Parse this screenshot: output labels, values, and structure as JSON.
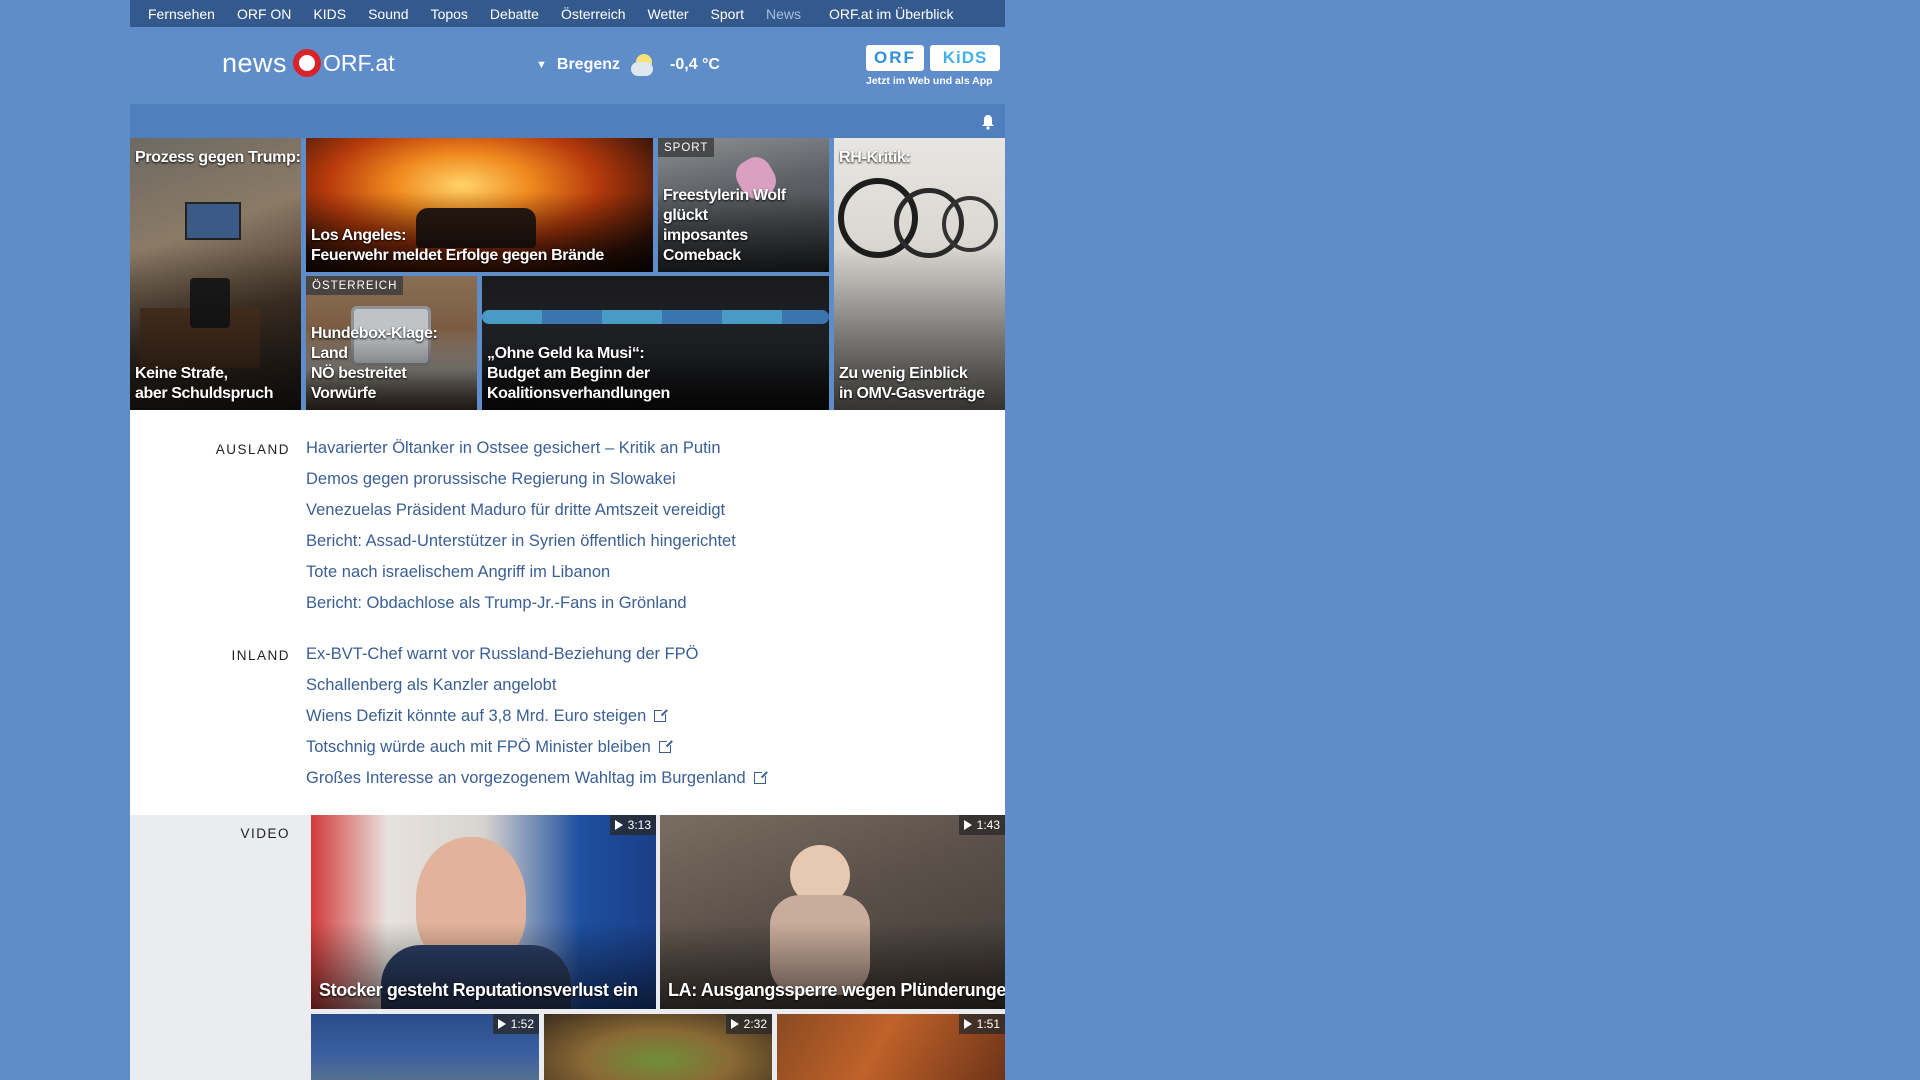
{
  "nav": {
    "items": [
      "Fernsehen",
      "ORF ON",
      "KIDS",
      "Sound",
      "Topos",
      "Debatte",
      "Österreich",
      "Wetter",
      "Sport",
      "News"
    ],
    "active": "News",
    "overview": "ORF.at im Überblick"
  },
  "header": {
    "logo_news": "news",
    "logo_orf": "ORF.at",
    "weather_city": "Bregenz",
    "weather_temp": "-0,4 °C",
    "weather_icon": "partly-cloudy-night-icon",
    "kids_orf": "ORF",
    "kids_label": "KiDS",
    "kids_tagline": "Jetzt im Web und als App"
  },
  "top_stories": [
    {
      "kicker": "Prozess gegen Trump:",
      "headline": "Keine Strafe,\naber Schuldspruch",
      "tag": ""
    },
    {
      "kicker": "",
      "headline": "Los Angeles:\nFeuerwehr meldet Erfolge gegen Brände",
      "tag": ""
    },
    {
      "kicker": "",
      "headline": "Freestylerin Wolf glückt\nimposantes Comeback",
      "tag": "SPORT"
    },
    {
      "kicker": "RH-Kritik:",
      "headline": "Zu wenig Einblick\nin OMV-Gasverträge",
      "tag": ""
    },
    {
      "kicker": "",
      "headline": "Hundebox-Klage: Land\nNÖ bestreitet Vorwürfe",
      "tag": "ÖSTERREICH"
    },
    {
      "kicker": "",
      "headline": "„Ohne Geld ka Musi“:\nBudget am Beginn der Koalitionsverhandlungen",
      "tag": ""
    }
  ],
  "ausland": {
    "label": "AUSLAND",
    "links": [
      "Havarierter Öltanker in Ostsee gesichert – Kritik an Putin",
      "Demos gegen prorussische Regierung in Slowakei",
      "Venezuelas Präsident Maduro für dritte Amtszeit vereidigt",
      "Bericht: Assad-Unterstützer in Syrien öffentlich hingerichtet",
      "Tote nach israelischem Angriff im Libanon",
      "Bericht: Obdachlose als Trump-Jr.-Fans in Grönland"
    ]
  },
  "inland": {
    "label": "INLAND",
    "links": [
      "Ex-BVT-Chef warnt vor Russland-Beziehung der FPÖ",
      "Schallenberg als Kanzler angelobt",
      "Wiens Defizit könnte auf 3,8 Mrd. Euro steigen",
      "Totschnig würde auch mit FPÖ Minister bleiben",
      "Großes Interesse an vorgezogenem Wahltag im Burgenland"
    ]
  },
  "video": {
    "label": "VIDEO",
    "items": [
      {
        "headline": "Stocker gesteht Reputationsverlust ein",
        "duration": "3:13"
      },
      {
        "headline": "LA: Ausgangssperre wegen Plünderungen",
        "duration": "1:43"
      },
      {
        "headline": "",
        "duration": "1:52"
      },
      {
        "headline": "",
        "duration": "2:32"
      },
      {
        "headline": "",
        "duration": "1:51"
      }
    ]
  },
  "colors": {
    "page_bg": "#5e8dc9",
    "topnav_bg": "#345a8d",
    "link": "#3a5f94",
    "logo_red": "#d8232a"
  }
}
